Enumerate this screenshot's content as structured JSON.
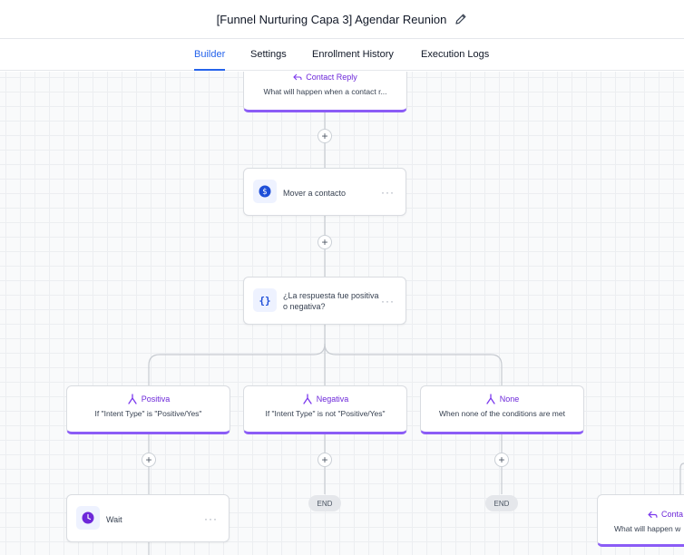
{
  "header": {
    "title": "[Funnel Nurturing Capa 3] Agendar Reunion",
    "edit_icon": "pencil-icon"
  },
  "tabs": [
    {
      "label": "Builder",
      "active": true
    },
    {
      "label": "Settings",
      "active": false
    },
    {
      "label": "Enrollment History",
      "active": false
    },
    {
      "label": "Execution Logs",
      "active": false
    }
  ],
  "nodes": {
    "contact_reply_top": {
      "title": "Contact Reply",
      "subtitle": "What will happen when a contact r..."
    },
    "move_contact": {
      "label": "Mover a contacto",
      "icon": "dollar-icon"
    },
    "condition": {
      "label_line1": "¿La respuesta fue positiva",
      "label_line2": "o negativa?",
      "icon": "braces-icon"
    },
    "branch_positiva": {
      "title": "Positiva",
      "subtitle": "If \"Intent Type\" is \"Positive/Yes\""
    },
    "branch_negativa": {
      "title": "Negativa",
      "subtitle": "If \"Intent Type\" is not \"Positive/Yes\""
    },
    "branch_none": {
      "title": "None",
      "subtitle": "When none of the conditions are met"
    },
    "wait": {
      "label": "Wait",
      "icon": "clock-icon"
    },
    "contact_reply_right": {
      "title": "Conta",
      "subtitle": "What will happen w"
    }
  },
  "end_label": "END",
  "more_label": "···",
  "plus_label": "+",
  "colors": {
    "accent": "#2563eb",
    "branch": "#8b5cf6",
    "wait_icon": "#6d28d9",
    "dollar_icon": "#1d4ed8"
  }
}
